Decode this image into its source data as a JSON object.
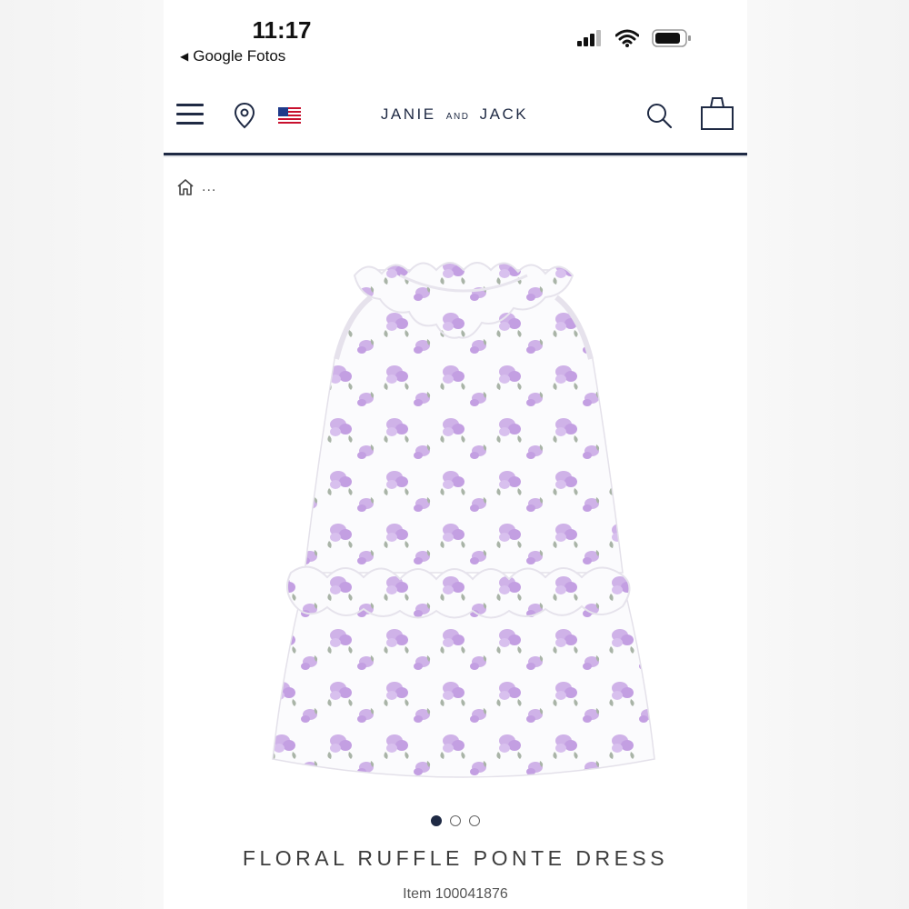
{
  "status_bar": {
    "time": "11:17",
    "back_app": "Google Fotos",
    "back_arrow": "◀"
  },
  "header": {
    "brand_left": "JANIE",
    "brand_mid": "AND",
    "brand_right": "JACK",
    "menu_icon": "hamburger-icon",
    "location_icon": "map-pin-icon",
    "flag_icon": "us-flag-icon",
    "search_icon": "search-icon",
    "bag_icon": "shopping-bag-icon",
    "accent_color": "#1f2a44"
  },
  "breadcrumb": {
    "home_icon": "home-icon",
    "more": "..."
  },
  "carousel": {
    "active_index": 0,
    "count": 3
  },
  "product": {
    "title": "FLORAL RUFFLE PONTE DRESS",
    "item_number": "Item 100041876",
    "print_color": "#c9a6e4",
    "leaf_color": "#9aa89b"
  }
}
